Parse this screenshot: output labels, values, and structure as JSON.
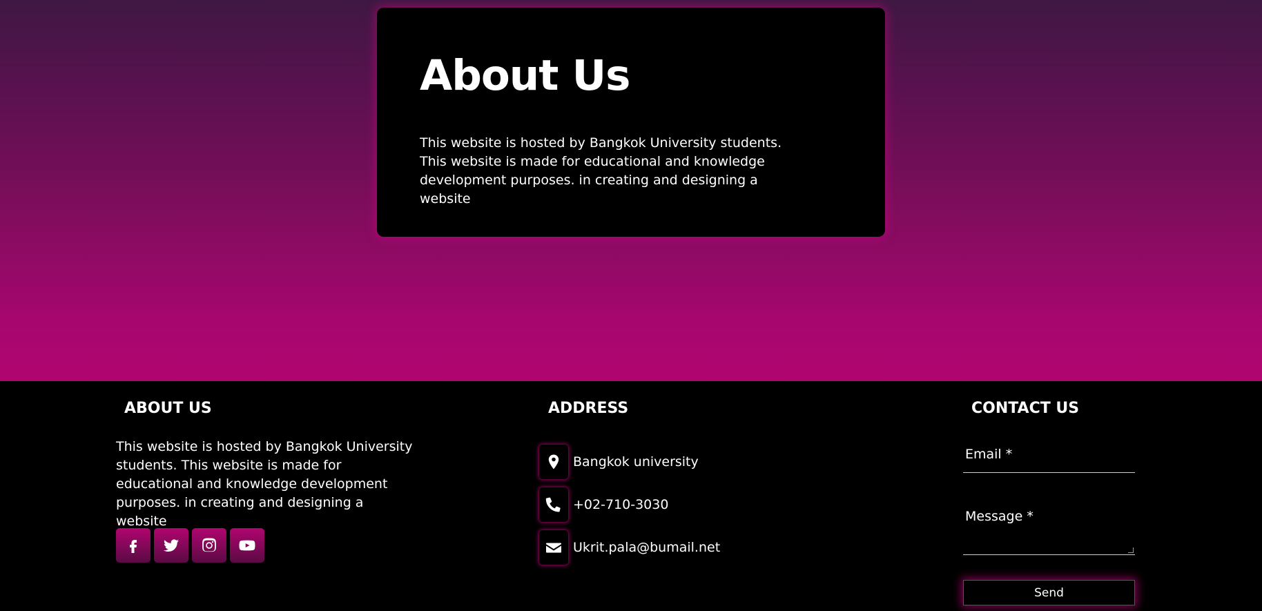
{
  "hero": {
    "title": "About Us",
    "description": "This website is hosted by Bangkok University students. This website is made for educational and knowledge development purposes. in creating and designing a website"
  },
  "footer": {
    "about": {
      "title": "ABOUT US",
      "text": "This website is hosted by Bangkok University students. This website is made for educational and knowledge development purposes. in creating and designing a website",
      "socials": [
        "facebook-icon",
        "twitter-icon",
        "instagram-icon",
        "youtube-icon"
      ]
    },
    "address": {
      "title": "ADDRESS",
      "location": "Bangkok university",
      "phone": "+02-710-3030",
      "email": "Ukrit.pala@bumail.net"
    },
    "contact": {
      "title": "CONTACT US",
      "email_label": "Email *",
      "message_label": "Message *",
      "send_label": "Send"
    }
  },
  "colors": {
    "accent": "#b0056f",
    "gradient_top": "#3f1843",
    "background": "#000000"
  }
}
